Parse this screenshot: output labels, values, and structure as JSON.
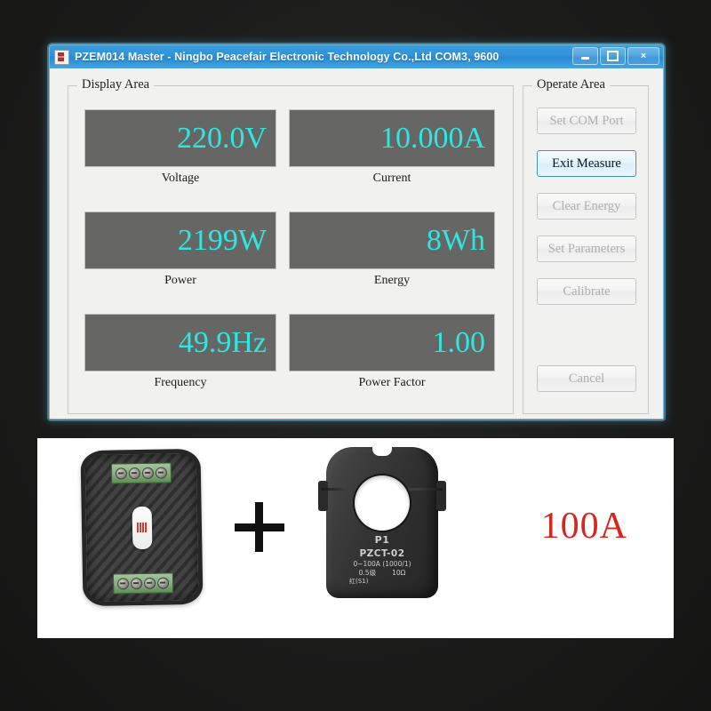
{
  "window": {
    "title": "PZEM014 Master - Ningbo Peacefair Electronic Technology Co.,Ltd  COM3, 9600",
    "icon": "app-icon",
    "controls": {
      "minimize": "minimize-icon",
      "maximize": "maximize-icon",
      "close": "×"
    }
  },
  "display_area": {
    "title": "Display Area",
    "readouts": [
      {
        "value": "220.0V",
        "label": "Voltage"
      },
      {
        "value": "10.000A",
        "label": "Current"
      },
      {
        "value": "2199W",
        "label": "Power"
      },
      {
        "value": "8Wh",
        "label": "Energy"
      },
      {
        "value": "49.9Hz",
        "label": "Frequency"
      },
      {
        "value": "1.00",
        "label": "Power Factor"
      }
    ],
    "value_color": "#2fe6e0",
    "panel_color": "#666664"
  },
  "operate_area": {
    "title": "Operate Area",
    "buttons": [
      {
        "label": "Set COM Port",
        "enabled": false
      },
      {
        "label": "Exit Measure",
        "enabled": true
      },
      {
        "label": "Clear Energy",
        "enabled": false
      },
      {
        "label": "Set Parameters",
        "enabled": false
      },
      {
        "label": "Calibrate",
        "enabled": false
      },
      {
        "label": "Cancel",
        "enabled": false
      }
    ],
    "focus_color": "#3c93c2"
  },
  "product_photo": {
    "module": {
      "name": "pzem-module"
    },
    "plus": "+",
    "ct_clamp": {
      "line1": "P1",
      "line2": "PZCT-02",
      "line3": "0~100A (1000/1)",
      "line4_left": "0.5级",
      "line4_right": "10Ω",
      "line5": "红(S1)"
    },
    "rating": "100A",
    "rating_color": "#d8251f"
  }
}
